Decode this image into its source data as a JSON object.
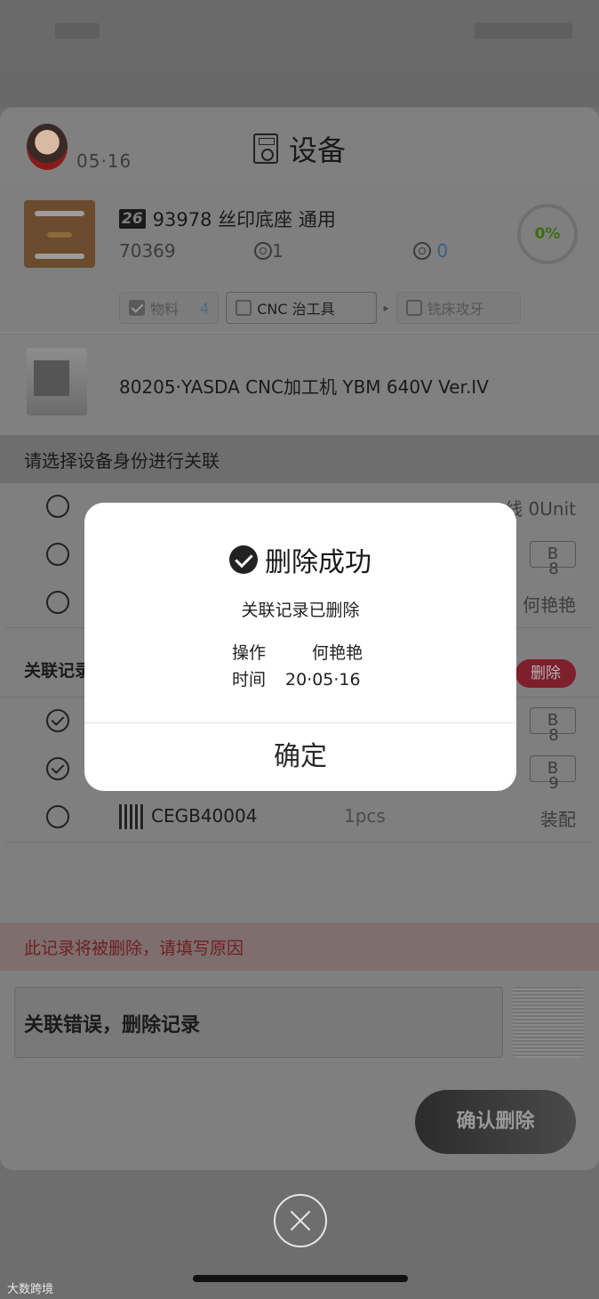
{
  "header": {
    "date": "05·16",
    "title": "设备"
  },
  "product": {
    "badge": "26",
    "name": "93978 丝印底座 通用",
    "code": "70369",
    "gear_count_1": "1",
    "gear_count_2": "0",
    "progress": "0%"
  },
  "chips": [
    {
      "label": "物料",
      "count": "4",
      "checked": true
    },
    {
      "label": "CNC 治工具",
      "checked": false
    },
    {
      "label": "铣床攻牙",
      "checked": false
    }
  ],
  "machine": {
    "label": "80205·YASDA CNC加工机 YBM 640V Ver.IV"
  },
  "select_section": {
    "title": "请选择设备身份进行关联"
  },
  "select_rows": [
    {
      "right": "线 0Unit"
    },
    {
      "tag": "B",
      "tag_sub": "8"
    },
    {
      "right": "何艳艳"
    }
  ],
  "assoc_section": {
    "title": "关联记录",
    "delete_label": "删除"
  },
  "assoc_rows": [
    {
      "tag": "B",
      "tag_sub": "8"
    },
    {
      "tag": "B",
      "tag_sub": "9"
    },
    {
      "code": "CEGB40004",
      "qty": "1pcs",
      "right": "装配"
    }
  ],
  "warning": {
    "text": "此记录将被删除，请填写原因"
  },
  "reason": {
    "value": "关联错误，删除记录"
  },
  "actions": {
    "confirm_delete": "确认删除"
  },
  "dialog": {
    "title": "删除成功",
    "subtitle": "关联记录已删除",
    "operator_label": "操作",
    "operator_value": "何艳艳",
    "time_label": "时间",
    "time_value": "20·05·16",
    "ok": "确定"
  },
  "watermark": "大数跨境",
  "colors": {
    "progress_text": "#3c6d12",
    "delete_pill": "#7e1f2c",
    "warning_text": "#6e1f1f"
  }
}
